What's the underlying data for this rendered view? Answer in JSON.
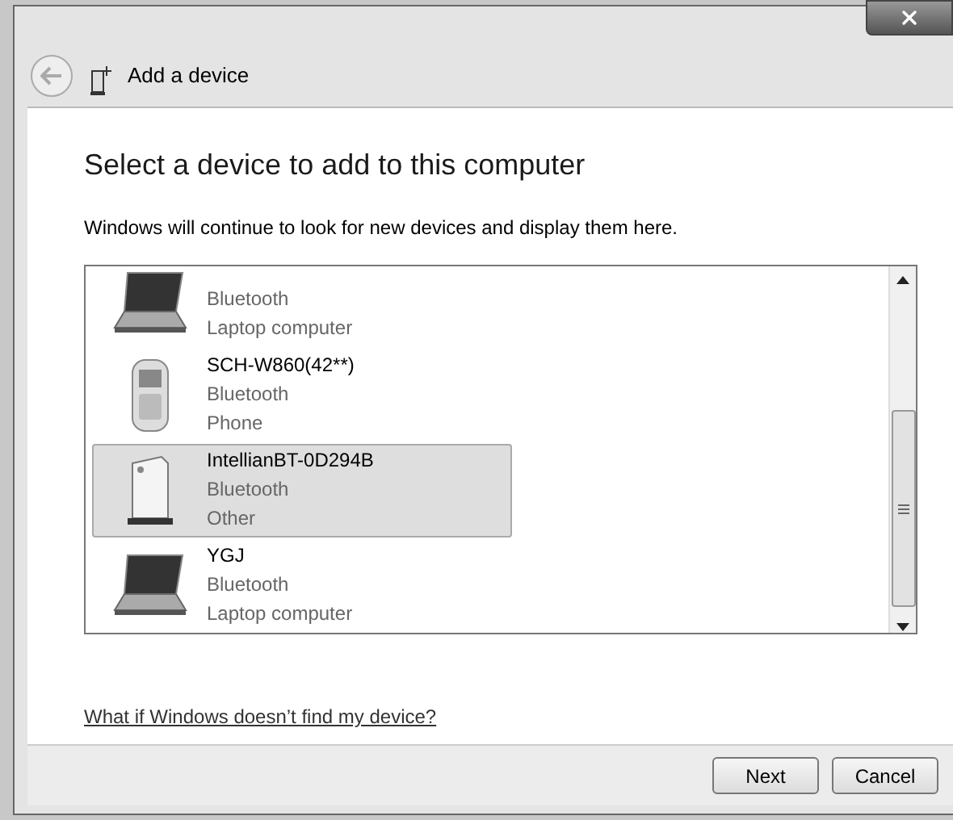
{
  "window": {
    "title": "Add a device"
  },
  "heading": "Select a device to add to this computer",
  "subtitle": "Windows will continue to look for new devices and display them here.",
  "devices": [
    {
      "kind": "laptop",
      "connection": "Bluetooth",
      "type": "Laptop computer",
      "selected": false
    },
    {
      "kind": "phone",
      "name": "SCH-W860(42**)",
      "connection": "Bluetooth",
      "type": "Phone",
      "selected": false
    },
    {
      "kind": "other",
      "name": "IntellianBT-0D294B",
      "connection": "Bluetooth",
      "type": "Other",
      "selected": true
    },
    {
      "kind": "laptop",
      "name": "YGJ",
      "connection": "Bluetooth",
      "type": "Laptop computer",
      "selected": false
    }
  ],
  "help_link": "What if Windows doesn’t find my device?",
  "buttons": [
    "Next",
    "Cancel"
  ]
}
